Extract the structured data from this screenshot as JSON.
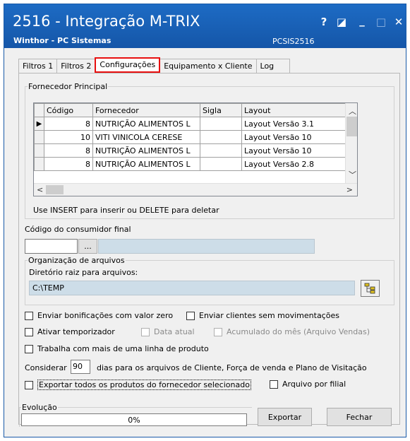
{
  "window": {
    "title": "2516 - Integração M-TRIX",
    "subtitle": "Winthor - PC Sistemas",
    "routine_code": "PCSIS2516",
    "buttons": {
      "help": "?",
      "edit": "◪",
      "minimize": "_",
      "maximize": "□",
      "close": "✕"
    }
  },
  "tabs": [
    {
      "label": "Filtros 1",
      "active": false
    },
    {
      "label": "Filtros 2",
      "active": false
    },
    {
      "label": "Configurações",
      "active": true
    },
    {
      "label": "Equipamento x Cliente",
      "active": false
    },
    {
      "label": "Log",
      "active": false
    }
  ],
  "fornecedor": {
    "group_label": "Fornecedor  Principal",
    "columns": [
      "Código",
      "Fornecedor",
      "Sigla",
      "Layout"
    ],
    "rows": [
      {
        "codigo": "8",
        "fornecedor": "NUTRIÇÃO ALIMENTOS L",
        "sigla": "",
        "layout": "Layout Versão 3.1",
        "current": true
      },
      {
        "codigo": "10",
        "fornecedor": "VITI VINICOLA CERESE",
        "sigla": "",
        "layout": "Layout Versão 10",
        "current": false
      },
      {
        "codigo": "8",
        "fornecedor": "NUTRIÇÃO ALIMENTOS L",
        "sigla": "",
        "layout": "Layout Versão 10",
        "current": false
      },
      {
        "codigo": "8",
        "fornecedor": "NUTRIÇÃO ALIMENTOS L",
        "sigla": "",
        "layout": "Layout Versão 2.8",
        "current": false
      }
    ],
    "hint": "Use INSERT para inserir ou DELETE para deletar"
  },
  "consumidor": {
    "label": "Código do consumidor final",
    "code_value": "",
    "lookup_button": "...",
    "description_value": ""
  },
  "arquivos": {
    "group_label": "Organização de arquivos",
    "dir_label": "Diretório raiz para arquivos:",
    "dir_value": "C:\\TEMP"
  },
  "options": {
    "enviar_bonificacoes": "Enviar bonificações com valor zero",
    "enviar_clientes": "Enviar clientes sem movimentações",
    "ativar_temporizador": "Ativar temporizador",
    "data_atual": "Data atual",
    "acumulado_mes": "Acumulado do mês (Arquivo Vendas)",
    "mais_linha_produto": "Trabalha com mais de uma linha de produto",
    "considerar_label": "Considerar",
    "considerar_value": "90",
    "considerar_suffix": "dias para os arquivos de Cliente, Força de venda e Plano de Visitação",
    "exportar_todos": "Exportar todos os produtos do fornecedor selecionado",
    "arquivo_filial": "Arquivo por filial"
  },
  "evolucao": {
    "label": "Evolução",
    "progress_text": "0%",
    "progress_value": 0
  },
  "actions": {
    "exportar": "Exportar",
    "fechar": "Fechar"
  }
}
